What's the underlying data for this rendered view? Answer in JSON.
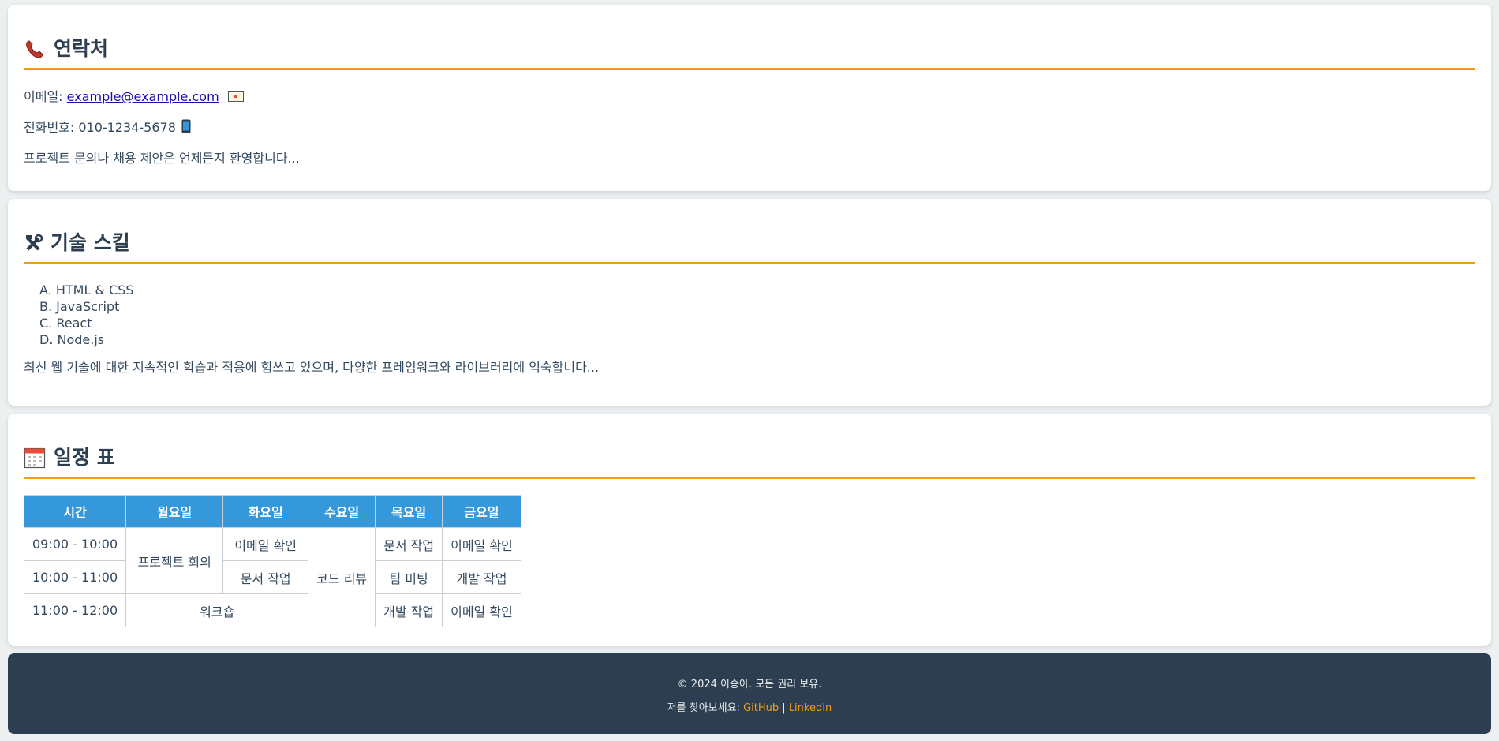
{
  "contact": {
    "title": "연락처",
    "email_label": "이메일:",
    "email": "example@example.com",
    "phone_label": "전화번호:",
    "phone": "010-1234-5678",
    "note": "프로젝트 문의나 채용 제안은 언제든지 환영합니다..."
  },
  "skills": {
    "title": "기술 스킬",
    "items": [
      {
        "marker": "A.",
        "label": "HTML & CSS"
      },
      {
        "marker": "B.",
        "label": "JavaScript"
      },
      {
        "marker": "C.",
        "label": "React"
      },
      {
        "marker": "D.",
        "label": "Node.js"
      }
    ],
    "description": "최신 웹 기술에 대한 지속적인 학습과 적용에 힘쓰고 있으며, 다양한 프레임워크와 라이브러리에 익숙합니다..."
  },
  "schedule": {
    "title": "일정 표",
    "headers": [
      "시간",
      "월요일",
      "화요일",
      "수요일",
      "목요일",
      "금요일"
    ],
    "times": [
      "09:00 - 10:00",
      "10:00 - 11:00",
      "11:00 - 12:00"
    ],
    "mon_meeting": "프로젝트 회의",
    "tue_1": "이메일 확인",
    "tue_2": "문서 작업",
    "workshop": "워크숍",
    "wed_review": "코드 리뷰",
    "thu": [
      "문서 작업",
      "팀 미팅",
      "개발 작업"
    ],
    "fri": [
      "이메일 확인",
      "개발 작업",
      "이메일 확인"
    ]
  },
  "footer": {
    "copyright": "© 2024 이승아. 모든 권리 보유.",
    "find_label": "저를 찾아보세요:",
    "github": "GitHub",
    "separator": "|",
    "linkedin": "LinkedIn"
  },
  "colors": {
    "accent": "#f39c12",
    "table_header": "#3498db",
    "footer_bg": "#2c3e50",
    "text": "#2c3e50"
  }
}
